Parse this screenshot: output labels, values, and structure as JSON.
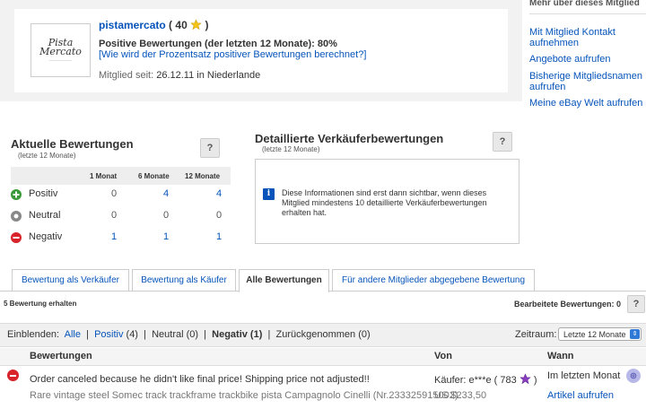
{
  "profile": {
    "logo_text": "Pista Mercato",
    "username": "pistamercato",
    "score": "40",
    "positive_line": "Positive Bewertungen (der letzten 12 Monate): 80%",
    "calc_link": "[Wie wird der Prozentsatz positiver Bewertungen berechnet?]",
    "member_since_label": "Mitglied seit:",
    "member_since_value": "26.12.11 in Niederlande"
  },
  "sidebar": {
    "title": "Mehr über dieses Mitglied",
    "links": [
      "Mit Mitglied Kontakt aufnehmen",
      "Angebote aufrufen",
      "Bisherige Mitgliedsnamen aufrufen",
      "Meine eBay Welt aufrufen"
    ]
  },
  "current_ratings": {
    "title": "Aktuelle Bewertungen",
    "subtitle": "(letzte 12 Monate)",
    "help": "?",
    "columns": [
      "1 Monat",
      "6 Monate",
      "12 Monate"
    ],
    "rows": [
      {
        "label": "Positiv",
        "values": [
          "0",
          "4",
          "4"
        ],
        "color": "#3a9a3a"
      },
      {
        "label": "Neutral",
        "values": [
          "0",
          "0",
          "0"
        ],
        "color": "#888888"
      },
      {
        "label": "Negativ",
        "values": [
          "1",
          "1",
          "1"
        ],
        "color": "#d8232a"
      }
    ]
  },
  "detailed_ratings": {
    "title": "Detaillierte Verkäuferbewertungen",
    "subtitle": "(letzte 12 Monate)",
    "help": "?",
    "info": "Diese Informationen sind erst dann sichtbar, wenn dieses Mitglied mindestens 10 detaillierte Verkäuferbewertungen erhalten hat."
  },
  "tabs": [
    "Bewertung als Verkäufer",
    "Bewertung als Käufer",
    "Alle Bewertungen",
    "Für andere Mitglieder abgegebene Bewertung"
  ],
  "active_tab": "Alle Bewertungen",
  "summary": {
    "count": "5 Bewertung erhalten",
    "edited": "Bearbeitete Bewertungen: 0",
    "help": "?"
  },
  "filter": {
    "label": "Einblenden:",
    "all": "Alle",
    "positive": "Positiv",
    "positive_count": "(4)",
    "neutral": "Neutral (0)",
    "negative": "Negativ (1)",
    "withdrawn": "Zurückgenommen (0)",
    "period_label": "Zeitraum:",
    "period_value": "Letzte 12 Monate"
  },
  "feedback_table": {
    "headers": [
      "Bewertungen",
      "Von",
      "Wann"
    ],
    "entries": [
      {
        "type": "negative",
        "comment": "Order canceled because he didn't like final price! Shipping price not adjusted!!",
        "item": "Rare vintage steel Somec track trackframe trackbike pista Campagnolo Cinelli (Nr.233325915002)",
        "from": "Käufer: e***e ( 783",
        "from_close": ")",
        "price": "US $233,50",
        "when": "Im letzten Monat",
        "view_link": "Artikel aufrufen"
      }
    ]
  }
}
